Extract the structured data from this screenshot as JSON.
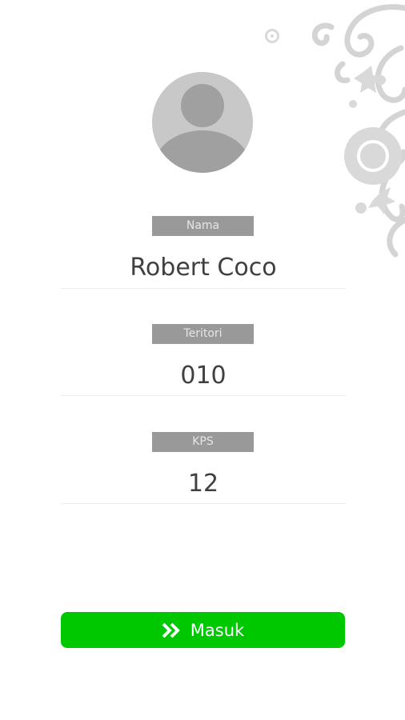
{
  "profile": {
    "avatar_icon": "user-avatar-icon",
    "fields": [
      {
        "label": "Nama",
        "value": "Robert Coco"
      },
      {
        "label": "Teritori",
        "value": "010"
      },
      {
        "label": "KPS",
        "value": "12"
      }
    ]
  },
  "login_button": {
    "label": "Masuk",
    "icon": "double-chevron-right-icon",
    "color": "#00c800"
  },
  "decoration": {
    "icon": "floral-ornament"
  },
  "colors": {
    "label_background": "#999999",
    "label_text": "#e6e6e6",
    "value_text": "#404040"
  }
}
